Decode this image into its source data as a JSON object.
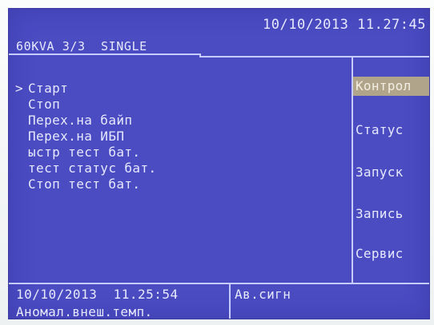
{
  "header": {
    "datetime": "10/10/2013 11.27:45",
    "model": "60KVA 3/3  SINGLE"
  },
  "commands": {
    "cursor": ">",
    "items": [
      "Старт",
      "Стоп",
      "Перех.на байп",
      "Перех.на ИБП",
      "ыстр тест бат.",
      "тест статус бат.",
      "Стоп тест бат."
    ],
    "indents": [
      0,
      0,
      0,
      0,
      0,
      1,
      0
    ],
    "selected_index": 0
  },
  "menu": {
    "items": [
      "Контрол",
      "Статус",
      "Запуск",
      "Запись",
      "Сервис"
    ],
    "active_index": 0,
    "active_color": "#b0a48a"
  },
  "status_bar": {
    "datetime": "10/10/2013  11.25:54",
    "message": "Аномал.внеш.темп.",
    "alarm_label": "Ав.сигн"
  },
  "colors": {
    "screen_background": "#4b4bc2",
    "text": "#e6e9ff",
    "divider": "#c7ccff"
  }
}
